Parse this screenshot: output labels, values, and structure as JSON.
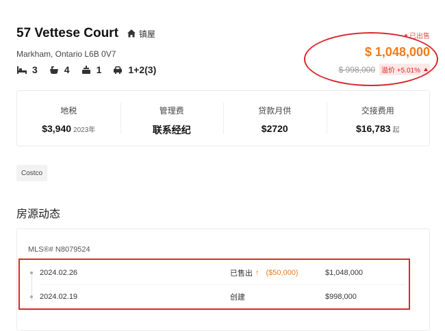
{
  "listing": {
    "title": "57 Vettese Court",
    "property_type": "镇屋",
    "address": "Markham, Ontario L6B 0V7",
    "features": {
      "bedrooms": "3",
      "bathrooms": "4",
      "kitchens": "1",
      "parking": "1+2(3)"
    },
    "status": "已出售",
    "price": "$ 1,048,000",
    "original_price": "$ 998,000",
    "premium": "溢价 +5.01%"
  },
  "stats": [
    {
      "label": "地税",
      "value": "$3,940",
      "suffix": "2023年"
    },
    {
      "label": "管理费",
      "value": "联系经纪",
      "suffix": ""
    },
    {
      "label": "贷款月供",
      "value": "$2720",
      "suffix": ""
    },
    {
      "label": "交接费用",
      "value": "$16,783",
      "suffix": "起"
    }
  ],
  "tag": "Costco",
  "history": {
    "section_title": "房源动态",
    "mls": "MLS®# N8079524",
    "rows": [
      {
        "date": "2024.02.26",
        "event": "已售出",
        "arrow": "↑",
        "delta": "($50,000)",
        "amount": "$1,048,000"
      },
      {
        "date": "2024.02.19",
        "event": "创建",
        "arrow": "",
        "delta": "",
        "amount": "$998,000"
      }
    ]
  },
  "colors": {
    "accent": "#f07b1a",
    "annotation_red": "#d9262c",
    "sold_red": "#e25555"
  },
  "icons": [
    "home-icon",
    "bed-icon",
    "bath-icon",
    "kitchen-icon",
    "car-icon"
  ]
}
